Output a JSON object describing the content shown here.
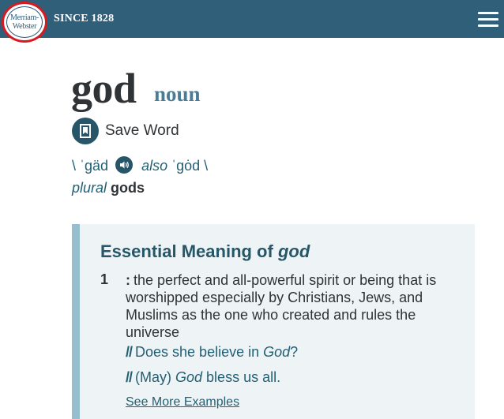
{
  "header": {
    "logo_line1": "Merriam-",
    "logo_line2": "Webster",
    "tagline": "SINCE 1828",
    "menu_icon": "hamburger-icon"
  },
  "entry": {
    "headword": "god",
    "part_of_speech": "noun",
    "save_label": "Save Word",
    "pronunciation": {
      "primary": "\\ ˈgäd",
      "also": "also",
      "alternate": "ˈgȯd \\"
    },
    "plural": {
      "label": "plural",
      "form": "gods"
    }
  },
  "essential": {
    "title_prefix": "Essential Meaning of",
    "title_word": "god",
    "sense": {
      "number": "1",
      "colon": ":",
      "definition": "the perfect and all-powerful spirit or being that is worshipped especially by Christians, Jews, and Muslims as the one who created and rules the universe"
    },
    "examples": [
      {
        "before": "Does she believe in ",
        "word": "God",
        "after": "?"
      },
      {
        "before": "(May) ",
        "word": "God",
        "after": " bless us all."
      }
    ],
    "see_more": "See More Examples",
    "example_marker": "//"
  },
  "colors": {
    "header_bg": "#305f7a",
    "accent": "#265667",
    "pos_color": "#4a7d95",
    "essential_bg": "#eef4f6",
    "essential_border": "#97bece"
  }
}
